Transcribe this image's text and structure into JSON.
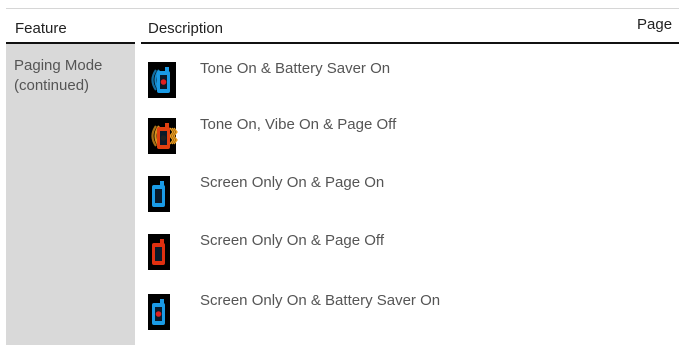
{
  "table": {
    "headers": {
      "feature": "Feature",
      "description": "Description",
      "page": "Page"
    },
    "feature": {
      "line1": "Paging Mode",
      "line2": "(continued)"
    },
    "rows": [
      {
        "label": "Tone On & Battery Saver On",
        "icon": "phone-tone-battery-saver-icon",
        "phone_color": "#1a9be6",
        "dot_color": "#e02020",
        "waves": "tone",
        "wave_color": "#1a9be6"
      },
      {
        "label": "Tone On, Vibe On & Page Off",
        "icon": "phone-tone-vibe-page-off-icon",
        "phone_color": "#e04010",
        "dot_color": "#202020",
        "waves": "tone-vibe",
        "wave_color": "#f0a020"
      },
      {
        "label": "Screen Only On & Page On",
        "icon": "phone-screen-only-page-on-icon",
        "phone_color": "#1a9be6",
        "dot_color": "",
        "waves": "none",
        "wave_color": ""
      },
      {
        "label": "Screen Only On & Page Off",
        "icon": "phone-screen-only-page-off-icon",
        "phone_color": "#e03010",
        "dot_color": "",
        "waves": "none",
        "wave_color": ""
      },
      {
        "label": "Screen Only On & Battery Saver On",
        "icon": "phone-screen-only-battery-saver-icon",
        "phone_color": "#1a9be6",
        "dot_color": "#e02020",
        "waves": "none",
        "wave_color": ""
      }
    ]
  }
}
